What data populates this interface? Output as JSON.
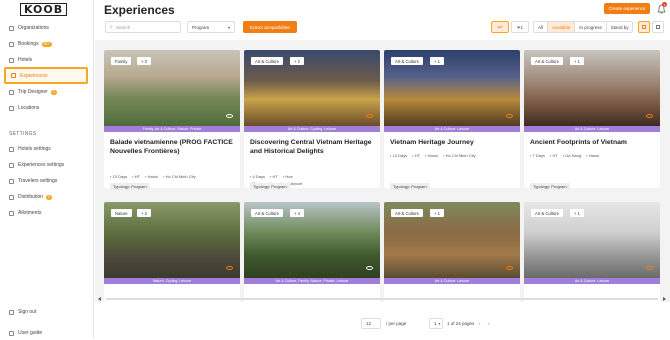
{
  "brand": "KOOB",
  "sidebar": {
    "items": [
      {
        "label": "Organizations"
      },
      {
        "label": "Bookings",
        "badge": "99+"
      },
      {
        "label": "Hotels"
      },
      {
        "label": "Experiences"
      },
      {
        "label": "Trip Designer",
        "badge": "0"
      },
      {
        "label": "Locations"
      }
    ],
    "settings_title": "SETTINGS",
    "settings": [
      {
        "label": "Hotels settings"
      },
      {
        "label": "Experiences settings"
      },
      {
        "label": "Travelers settings"
      },
      {
        "label": "Distribution",
        "badge": "0"
      },
      {
        "label": "Allotments"
      }
    ],
    "sign_out": "Sign out",
    "user_guide": "User guide"
  },
  "header": {
    "title": "Experiences",
    "create_label": "Create experience",
    "notif_count": "3",
    "search_placeholder": "Search",
    "program_select": "Program",
    "extract_label": "Extract compatibilities",
    "filter_count": "1",
    "segments": [
      "All",
      "Available",
      "In progress",
      "Stand by"
    ]
  },
  "cards": [
    {
      "chips": [
        "Family",
        "+ 3"
      ],
      "strip": "Family, Art & Culture, Nature, Private",
      "title": "Balade vietnamienne (PROG FACTICE Nouvelles Frontières)",
      "days": "13 Days",
      "code": "HT",
      "from": "Hanoi",
      "to": "Ho Chi Minh City",
      "extra": "",
      "tag": "Typology: Program"
    },
    {
      "chips": [
        "Art & Culture",
        "+ 2"
      ],
      "strip": "Art & Culture, Cycling, Leisure",
      "title": "Discovering Central Vietnam Heritage and Historical Delights",
      "days": "4 Days",
      "code": "HT",
      "from": "Hue",
      "to": "",
      "extra": "Danang International Airport",
      "tag": "Typology: Program"
    },
    {
      "chips": [
        "Art & Culture",
        "+ 1"
      ],
      "strip": "Art & Culture, Leisure",
      "title": "Vietnam Heritage Journey",
      "days": "10 Days",
      "code": "HT",
      "from": "Hanoi",
      "to": "Ho Chi Minh City",
      "extra": "",
      "tag": "Typology: Program"
    },
    {
      "chips": [
        "Art & Culture",
        "+ 1"
      ],
      "strip": "Art & Culture, Leisure",
      "title": "Ancient Footprints of Vietnam",
      "days": "7 Days",
      "code": "HT",
      "from": "Da Nang",
      "to": "Hanoi",
      "extra": "",
      "tag": "Typology: Program"
    },
    {
      "chips": [
        "Nature",
        "+ 2"
      ],
      "strip": "Nature, Cycling, Leisure",
      "title": "",
      "days": "",
      "code": "",
      "from": "",
      "to": "",
      "extra": "",
      "tag": ""
    },
    {
      "chips": [
        "Art & Culture",
        "+ 4"
      ],
      "strip": "Art & Culture, Family, Nature, Private, Leisure",
      "title": "",
      "days": "",
      "code": "",
      "from": "",
      "to": "",
      "extra": "",
      "tag": ""
    },
    {
      "chips": [
        "Art & Culture",
        "+ 1"
      ],
      "strip": "Art & Culture, Leisure",
      "title": "",
      "days": "",
      "code": "",
      "from": "",
      "to": "",
      "extra": "",
      "tag": ""
    },
    {
      "chips": [
        "Art & Culture",
        "+ 1"
      ],
      "strip": "Art & Culture, Leisure",
      "title": "",
      "days": "",
      "code": "",
      "from": "",
      "to": "",
      "extra": "",
      "tag": ""
    }
  ],
  "pager": {
    "per_page_value": "12",
    "per_page_label": "/ per page",
    "page": "1",
    "of_pages": "1 of 24 pages"
  },
  "colors": {
    "accent": "#f07e14",
    "strip": "#a07ed9"
  }
}
